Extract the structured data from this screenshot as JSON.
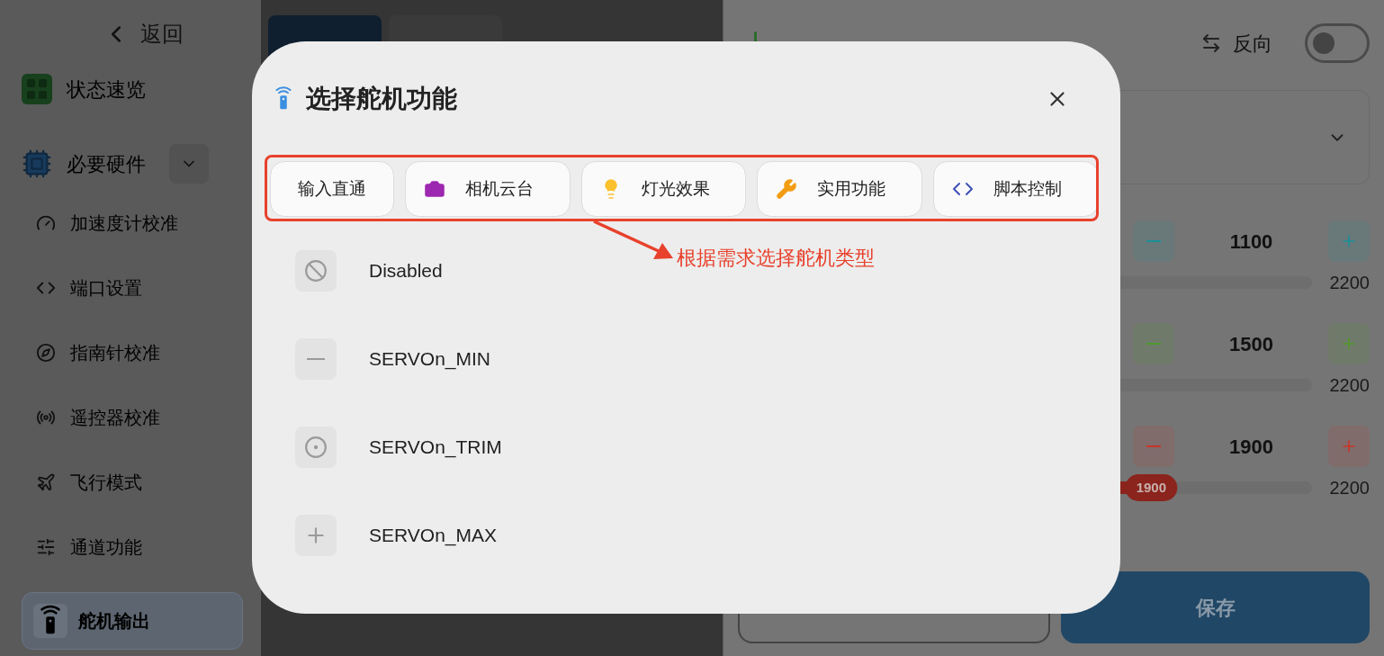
{
  "sidebar": {
    "back": "返回",
    "items": [
      {
        "label": "状态速览",
        "kind": "section"
      },
      {
        "label": "必要硬件",
        "kind": "group",
        "expanded": true,
        "children": [
          {
            "label": "加速度计校准",
            "selected": false
          },
          {
            "label": "端口设置",
            "selected": false
          },
          {
            "label": "指南针校准",
            "selected": false
          },
          {
            "label": "遥控器校准",
            "selected": false
          },
          {
            "label": "飞行模式",
            "selected": false
          },
          {
            "label": "通道功能",
            "selected": false
          },
          {
            "label": "舵机输出",
            "selected": true
          }
        ]
      }
    ]
  },
  "tabs": [
    {
      "selected": true
    },
    {
      "selected": false
    }
  ],
  "config": {
    "reverse": {
      "label": "反向",
      "on": false
    },
    "rows": [
      {
        "value": "1100",
        "max": "2200",
        "color": "#1b8f98"
      },
      {
        "value": "1500",
        "max": "2200",
        "color": "#4f9a2c"
      },
      {
        "value": "1900",
        "max": "2200",
        "color": "#c8352a",
        "level": 0.72,
        "thumb": "1900"
      }
    ],
    "buttons": [
      {
        "kind": "outline"
      },
      {
        "label": "保存",
        "kind": "primary"
      }
    ]
  },
  "dialog": {
    "title": "选择舵机功能",
    "categories": [
      {
        "label": "输入直通"
      },
      {
        "label": "相机云台"
      },
      {
        "label": "灯光效果"
      },
      {
        "label": "实用功能"
      },
      {
        "label": "脚本控制"
      }
    ],
    "options": [
      {
        "label": "Disabled"
      },
      {
        "label": "SERVOn_MIN"
      },
      {
        "label": "SERVOn_TRIM"
      },
      {
        "label": "SERVOn_MAX"
      }
    ]
  },
  "annotation": {
    "text": "根据需求选择舵机类型"
  }
}
